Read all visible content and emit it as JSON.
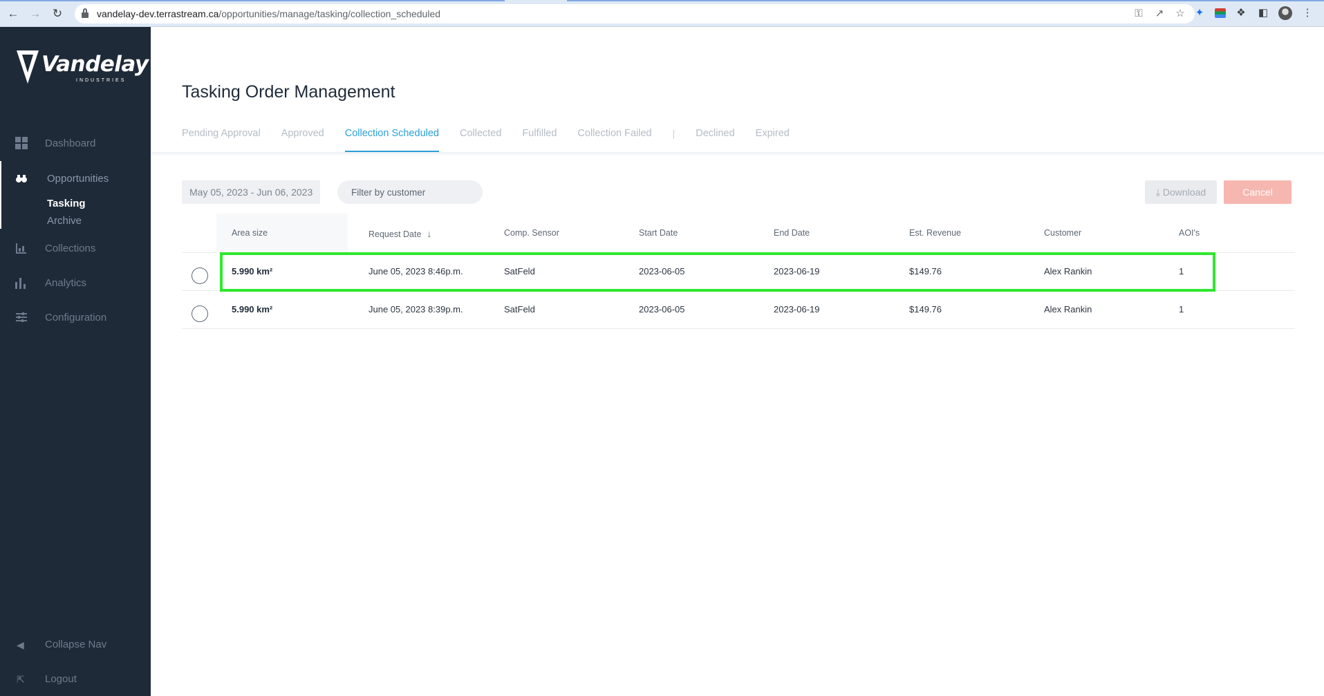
{
  "browser": {
    "url_host": "vandelay-dev.terrastream.ca",
    "url_path": "/opportunities/manage/tasking/collection_scheduled"
  },
  "sidebar": {
    "logo_text": "Vandelay",
    "logo_subtext": "INDUSTRIES",
    "items": [
      {
        "label": "Dashboard",
        "icon": "dashboard-icon"
      },
      {
        "label": "Opportunities",
        "icon": "binoculars-icon"
      },
      {
        "label": "Collections",
        "icon": "collections-icon"
      },
      {
        "label": "Analytics",
        "icon": "bar-chart-icon"
      },
      {
        "label": "Configuration",
        "icon": "sliders-icon"
      }
    ],
    "sub_items": [
      "Tasking",
      "Archive"
    ],
    "collapse_label": "Collapse Nav",
    "logout_label": "Logout"
  },
  "page": {
    "title": "Tasking Order Management",
    "tabs": [
      "Pending Approval",
      "Approved",
      "Collection Scheduled",
      "Collected",
      "Fulfilled",
      "Collection Failed",
      "Declined",
      "Expired"
    ],
    "selected_tab": "Collection Scheduled",
    "tab_separator": "|"
  },
  "toolbar": {
    "date_range": "May 05, 2023  -  Jun 06, 2023",
    "filter_placeholder": "Filter by customer",
    "download_label": "Download",
    "cancel_label": "Cancel"
  },
  "table": {
    "columns": [
      "Area size",
      "Request Date",
      "Comp. Sensor",
      "Start Date",
      "End Date",
      "Est. Revenue",
      "Customer",
      "AOI's"
    ],
    "rows": [
      {
        "area": "5.990 km²",
        "request_date": "June 05, 2023 8:46p.m.",
        "sensor": "SatFeld",
        "start": "2023-06-05",
        "end": "2023-06-19",
        "revenue": "$149.76",
        "customer": "Alex Rankin",
        "aois": "1"
      },
      {
        "area": "5.990 km²",
        "request_date": "June 05, 2023 8:39p.m.",
        "sensor": "SatFeld",
        "start": "2023-06-05",
        "end": "2023-06-19",
        "revenue": "$149.76",
        "customer": "Alex Rankin",
        "aois": "1"
      }
    ]
  },
  "colors": {
    "sidebar_bg": "#1f2a38",
    "accent": "#2a9fd8",
    "highlight": "#2ee82e",
    "cancel_bg": "#f6b7b0"
  }
}
